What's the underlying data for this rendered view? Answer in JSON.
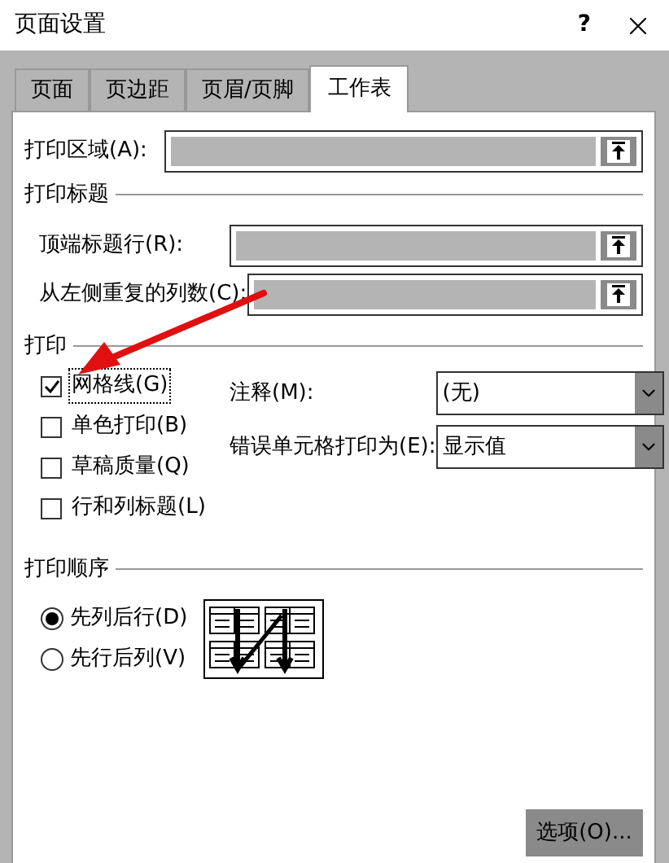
{
  "window": {
    "title": "页面设置",
    "help": "?"
  },
  "tabs": [
    {
      "label": "页面",
      "selected": false
    },
    {
      "label": "页边距",
      "selected": false
    },
    {
      "label": "页眉/页脚",
      "selected": false
    },
    {
      "label": "工作表",
      "selected": true
    }
  ],
  "print_area": {
    "label": "打印区域(A):"
  },
  "print_titles": {
    "heading": "打印标题",
    "fields": [
      {
        "label": "顶端标题行(R):"
      },
      {
        "label": "从左侧重复的列数(C):"
      }
    ]
  },
  "print": {
    "heading": "打印",
    "checkboxes": [
      {
        "label": "网格线(G)",
        "checked": true,
        "focused": true
      },
      {
        "label": "单色打印(B)",
        "checked": false,
        "focused": false
      },
      {
        "label": "草稿质量(Q)",
        "checked": false,
        "focused": false
      },
      {
        "label": "行和列标题(L)",
        "checked": false,
        "focused": false
      }
    ],
    "dropdowns": [
      {
        "label": "注释(M):",
        "value": "(无)"
      },
      {
        "label": "错误单元格打印为(E):",
        "value": "显示值"
      }
    ]
  },
  "page_order": {
    "heading": "打印顺序",
    "options": [
      {
        "label": "先列后行(D)",
        "selected": true
      },
      {
        "label": "先行后列(V)",
        "selected": false
      }
    ]
  },
  "buttons": [
    {
      "label": "选项(O)..."
    }
  ]
}
